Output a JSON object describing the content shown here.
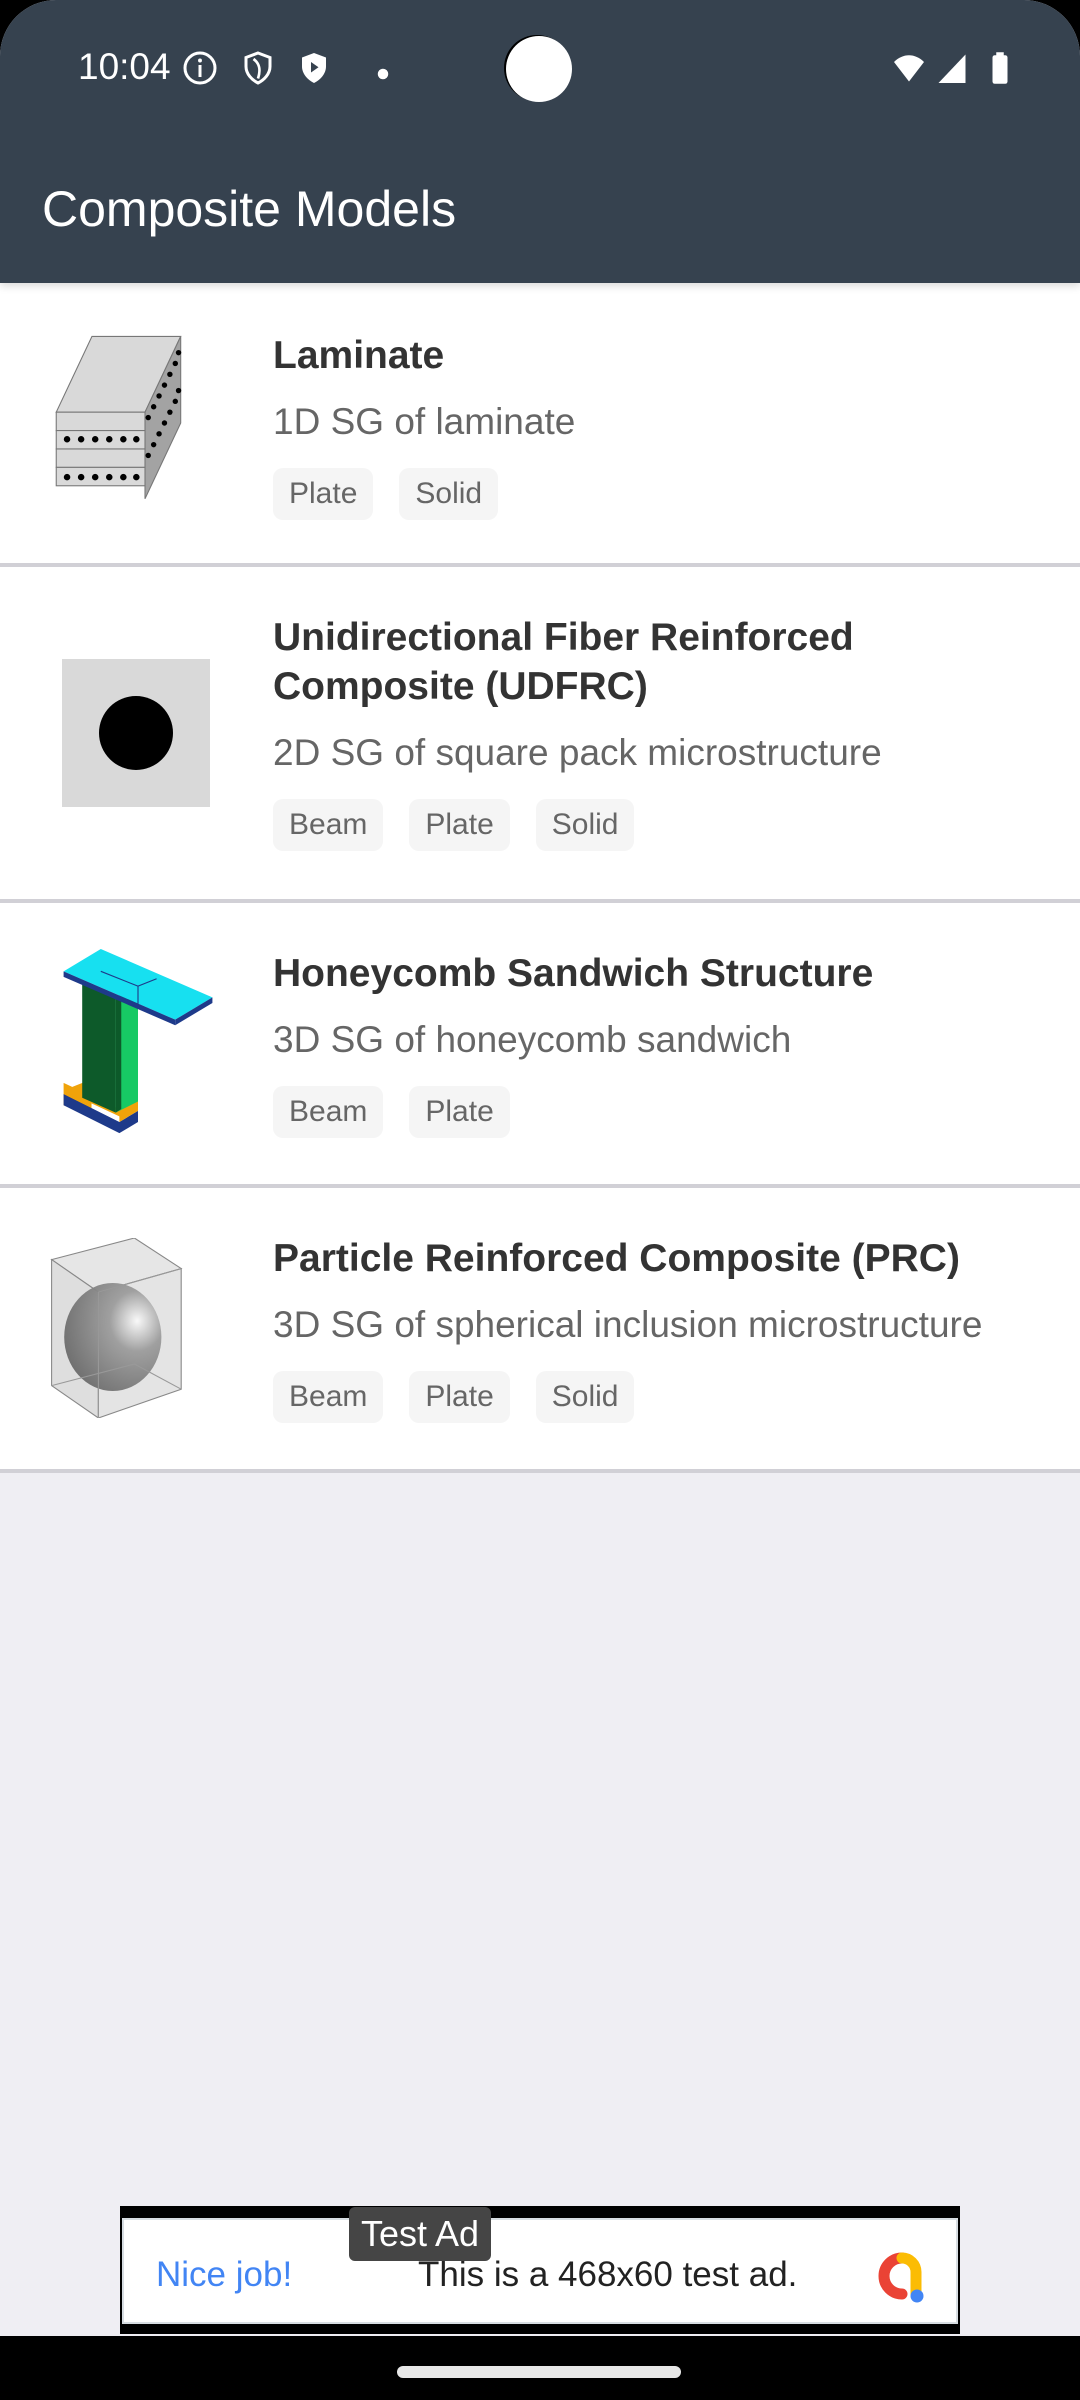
{
  "status_bar": {
    "time": "10:04",
    "left_icons": [
      "info-icon",
      "shield-icon",
      "shield-play-icon",
      "notification-dot-icon"
    ],
    "right_icons": [
      "wifi-icon",
      "signal-icon",
      "battery-icon"
    ]
  },
  "app_bar": {
    "title": "Composite Models",
    "background": "#36424f"
  },
  "models": [
    {
      "title": "Laminate",
      "description": "1D SG of laminate",
      "tags": [
        "Plate",
        "Solid"
      ],
      "thumbnail": "laminate-icon"
    },
    {
      "title": "Unidirectional Fiber Reinforced Composite (UDFRC)",
      "description": "2D SG of square pack microstructure",
      "tags": [
        "Beam",
        "Plate",
        "Solid"
      ],
      "thumbnail": "udfrc-icon"
    },
    {
      "title": "Honeycomb Sandwich Structure",
      "description": "3D SG of honeycomb sandwich",
      "tags": [
        "Beam",
        "Plate"
      ],
      "thumbnail": "honeycomb-icon"
    },
    {
      "title": "Particle Reinforced Composite (PRC)",
      "description": "3D SG of spherical inclusion microstructure",
      "tags": [
        "Beam",
        "Plate",
        "Solid"
      ],
      "thumbnail": "prc-icon"
    }
  ],
  "ad": {
    "label": "Test Ad",
    "cta": "Nice job!",
    "text": "This is a 468x60 test ad.",
    "cta_color": "#4285f4"
  }
}
